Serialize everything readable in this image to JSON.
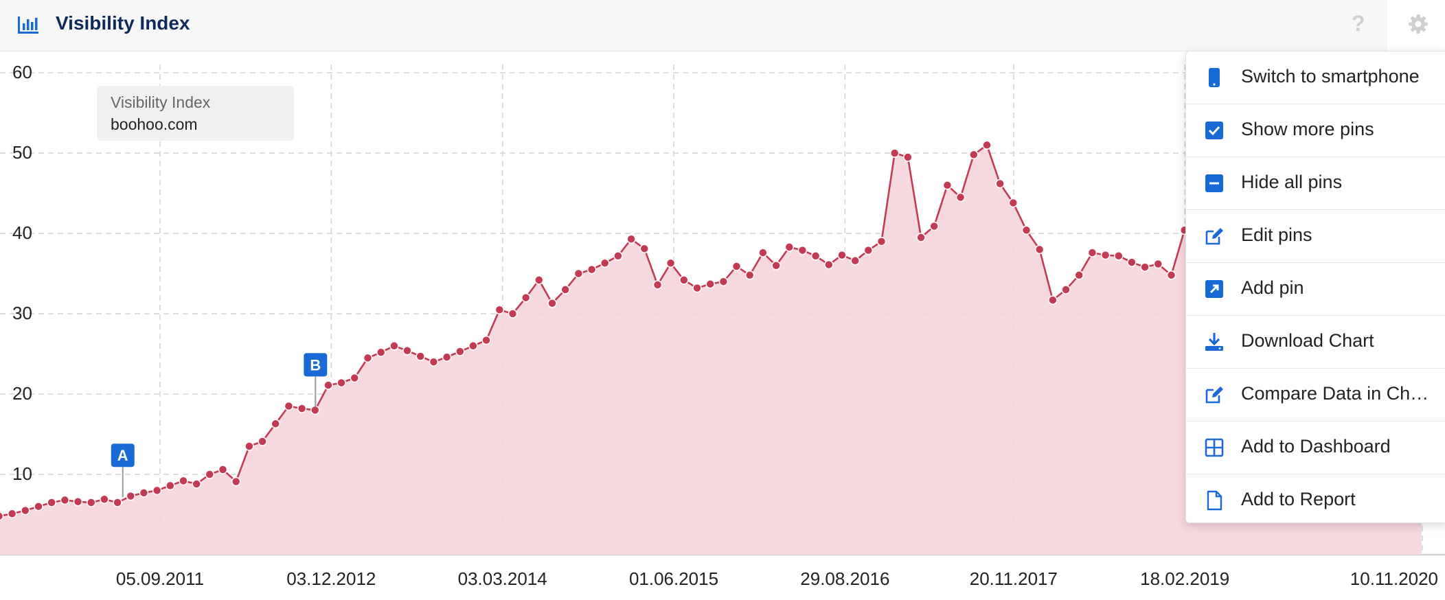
{
  "header": {
    "title": "Visibility Index",
    "icon": "bar-chart-icon",
    "help": "?"
  },
  "legend": {
    "label": "Visibility Index",
    "domain": "boohoo.com"
  },
  "colors": {
    "series": "#c23b52",
    "fill": "#f5d5dc",
    "pin": "#1a6ad6",
    "title": "#0d2a5c"
  },
  "menu": {
    "items": [
      {
        "label": "Switch to smartphone",
        "icon": "smartphone-icon"
      },
      {
        "label": "Show more pins",
        "icon": "checkbox-checked-icon"
      },
      {
        "label": "Hide all pins",
        "icon": "minus-square-icon"
      },
      {
        "label": "Edit pins",
        "icon": "edit-icon"
      },
      {
        "label": "Add pin",
        "icon": "external-arrow-icon"
      },
      {
        "label": "Download Chart",
        "icon": "download-icon"
      },
      {
        "label": "Compare Data in Ch…",
        "icon": "edit-icon"
      },
      {
        "label": "Add to Dashboard",
        "icon": "grid-icon"
      },
      {
        "label": "Add to Report",
        "icon": "document-icon"
      }
    ]
  },
  "chart_data": {
    "type": "area",
    "title": "Visibility Index",
    "ylim": [
      0,
      60
    ],
    "y_ticks": [
      10,
      20,
      30,
      40,
      50,
      60
    ],
    "x_tick_labels": [
      "05.09.2011",
      "03.12.2012",
      "03.03.2014",
      "01.06.2015",
      "29.08.2016",
      "20.11.2017",
      "18.02.2019",
      "10.11.2020"
    ],
    "grid": true,
    "series": [
      {
        "name": "boohoo.com",
        "x": [
          "03.01.2010",
          "07.02.2010",
          "21.03.2010",
          "25.04.2010",
          "30.05.2010",
          "04.07.2010",
          "08.08.2010",
          "12.09.2010",
          "17.10.2010",
          "21.11.2010",
          "26.12.2010",
          "30.01.2011",
          "06.03.2011",
          "10.04.2011",
          "15.05.2011",
          "19.06.2011",
          "24.07.2011",
          "28.08.2011",
          "02.10.2011",
          "06.11.2011",
          "11.12.2011",
          "15.01.2012",
          "19.02.2012",
          "25.03.2012",
          "29.04.2012",
          "03.06.2012",
          "08.07.2012",
          "12.08.2012",
          "16.09.2012",
          "21.10.2012",
          "25.11.2012",
          "30.12.2012",
          "03.02.2013",
          "10.03.2013",
          "14.04.2013",
          "19.05.2013",
          "23.06.2013",
          "28.07.2013",
          "01.09.2013",
          "06.10.2013",
          "10.11.2013",
          "15.12.2013",
          "19.01.2014",
          "23.02.2014",
          "30.03.2014",
          "04.05.2014",
          "08.06.2014",
          "13.07.2014",
          "17.08.2014",
          "21.09.2014",
          "26.10.2014",
          "30.11.2014",
          "04.01.2015",
          "08.02.2015",
          "15.03.2015",
          "19.04.2015",
          "24.05.2015",
          "28.06.2015",
          "02.08.2015",
          "06.09.2015",
          "11.10.2015",
          "15.11.2015",
          "20.12.2015",
          "24.01.2016",
          "28.02.2016",
          "03.04.2016",
          "08.05.2016",
          "12.06.2016",
          "17.07.2016",
          "21.08.2016",
          "25.09.2016",
          "30.10.2016",
          "04.12.2016",
          "08.01.2017",
          "12.02.2017",
          "19.03.2017",
          "23.04.2017",
          "28.05.2017",
          "02.07.2017",
          "06.08.2017",
          "10.09.2017",
          "15.10.2017",
          "19.11.2017",
          "24.12.2017",
          "28.01.2018",
          "04.03.2018",
          "08.04.2018",
          "13.05.2018",
          "17.06.2018",
          "22.07.2018",
          "26.08.2018",
          "30.09.2018",
          "04.11.2018",
          "09.12.2018",
          "13.01.2019",
          "17.02.2019",
          "24.03.2019",
          "28.04.2019",
          "02.06.2019",
          "07.07.2019",
          "11.08.2019",
          "15.09.2019",
          "20.10.2019",
          "24.11.2019",
          "29.12.2019",
          "02.02.2020",
          "08.03.2020",
          "12.04.2020",
          "17.05.2020",
          "21.06.2020",
          "26.07.2020",
          "30.08.2020",
          "04.10.2020",
          "08.11.2020"
        ],
        "values": [
          3.0,
          3.0,
          3.0,
          3.8,
          4.2,
          4.8,
          5.1,
          5.5,
          6.0,
          6.5,
          6.8,
          6.6,
          6.5,
          6.9,
          6.5,
          7.3,
          7.7,
          8.0,
          8.6,
          9.2,
          8.8,
          10.0,
          10.6,
          9.1,
          13.5,
          14.1,
          16.3,
          18.5,
          18.2,
          18.0,
          21.1,
          21.4,
          22.0,
          24.5,
          25.2,
          26.0,
          25.4,
          24.7,
          24.0,
          24.6,
          25.3,
          26.0,
          26.7,
          30.5,
          30.0,
          32.0,
          34.2,
          31.3,
          33.0,
          35.0,
          35.5,
          36.3,
          37.2,
          39.3,
          38.1,
          33.6,
          36.3,
          34.2,
          33.2,
          33.7,
          34.0,
          35.9,
          34.8,
          37.6,
          36.0,
          38.3,
          37.9,
          37.2,
          36.1,
          37.3,
          36.6,
          37.9,
          39.0,
          50.0,
          49.5,
          39.5,
          40.9,
          46.0,
          44.5,
          49.8,
          51.0,
          46.2,
          43.8,
          40.4,
          38.0,
          31.7,
          33.0,
          34.8,
          37.6,
          37.3,
          37.2,
          36.4,
          35.8,
          36.2,
          34.8,
          40.4,
          39.5,
          36.2,
          30.0,
          28.0,
          30.8,
          31.5,
          31.0,
          31.6,
          30.3,
          29.2,
          31.3,
          32.6,
          33.7,
          34.8,
          33.9,
          34.8,
          35.0,
          35.3
        ]
      }
    ],
    "pins": [
      {
        "label": "A",
        "x": "29.05.2011"
      },
      {
        "label": "B",
        "x": "22.10.2012"
      }
    ]
  }
}
